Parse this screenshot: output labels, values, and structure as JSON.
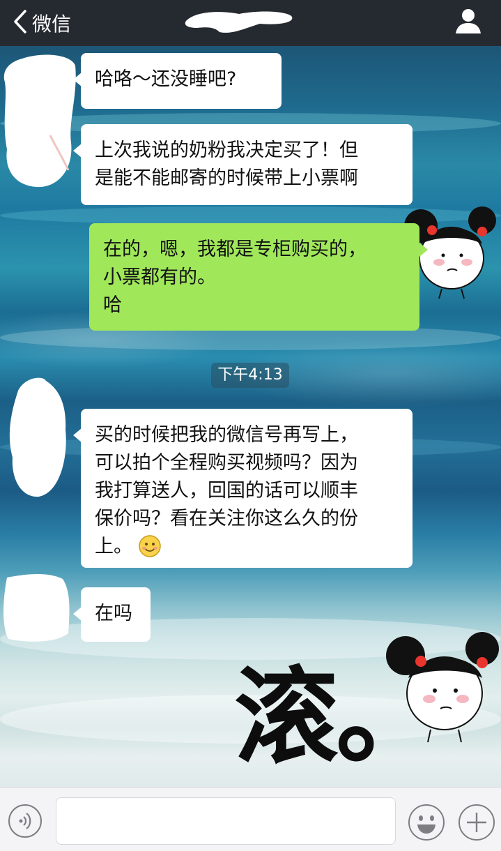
{
  "header": {
    "back_label": "微信",
    "title": "",
    "background_color": "#252a30"
  },
  "messages": [
    {
      "id": "m1",
      "side": "incoming",
      "lines": [
        "哈咯～还没睡吧?"
      ]
    },
    {
      "id": "m2",
      "side": "incoming",
      "lines": [
        "上次我说的奶粉我决定买了！但",
        "是能不能邮寄的时候带上小票啊"
      ]
    },
    {
      "id": "m3",
      "side": "outgoing",
      "lines": [
        "在的，嗯，我都是专柜购买的，",
        "小票都有的。",
        "哈"
      ]
    },
    {
      "id": "m4",
      "side": "incoming",
      "lines": [
        "买的时候把我的微信号再写上，",
        "可以拍个全程购买视频吗？因为",
        "我打算送人，回国的话可以顺丰",
        "保价吗？看在关注你这么久的份",
        "上。"
      ],
      "trailing_icon": "smile-emoji-icon"
    },
    {
      "id": "m5",
      "side": "incoming",
      "lines": [
        "在吗"
      ]
    }
  ],
  "timestamp": "下午4:13",
  "sticker": {
    "caption": "滚。",
    "icon": "pigtail-girl-sticker-icon"
  },
  "input": {
    "value": "",
    "placeholder": ""
  },
  "colors": {
    "incoming_bubble": "#ffffff",
    "outgoing_bubble": "#a0e75a",
    "input_bar": "#f4f4f6"
  }
}
